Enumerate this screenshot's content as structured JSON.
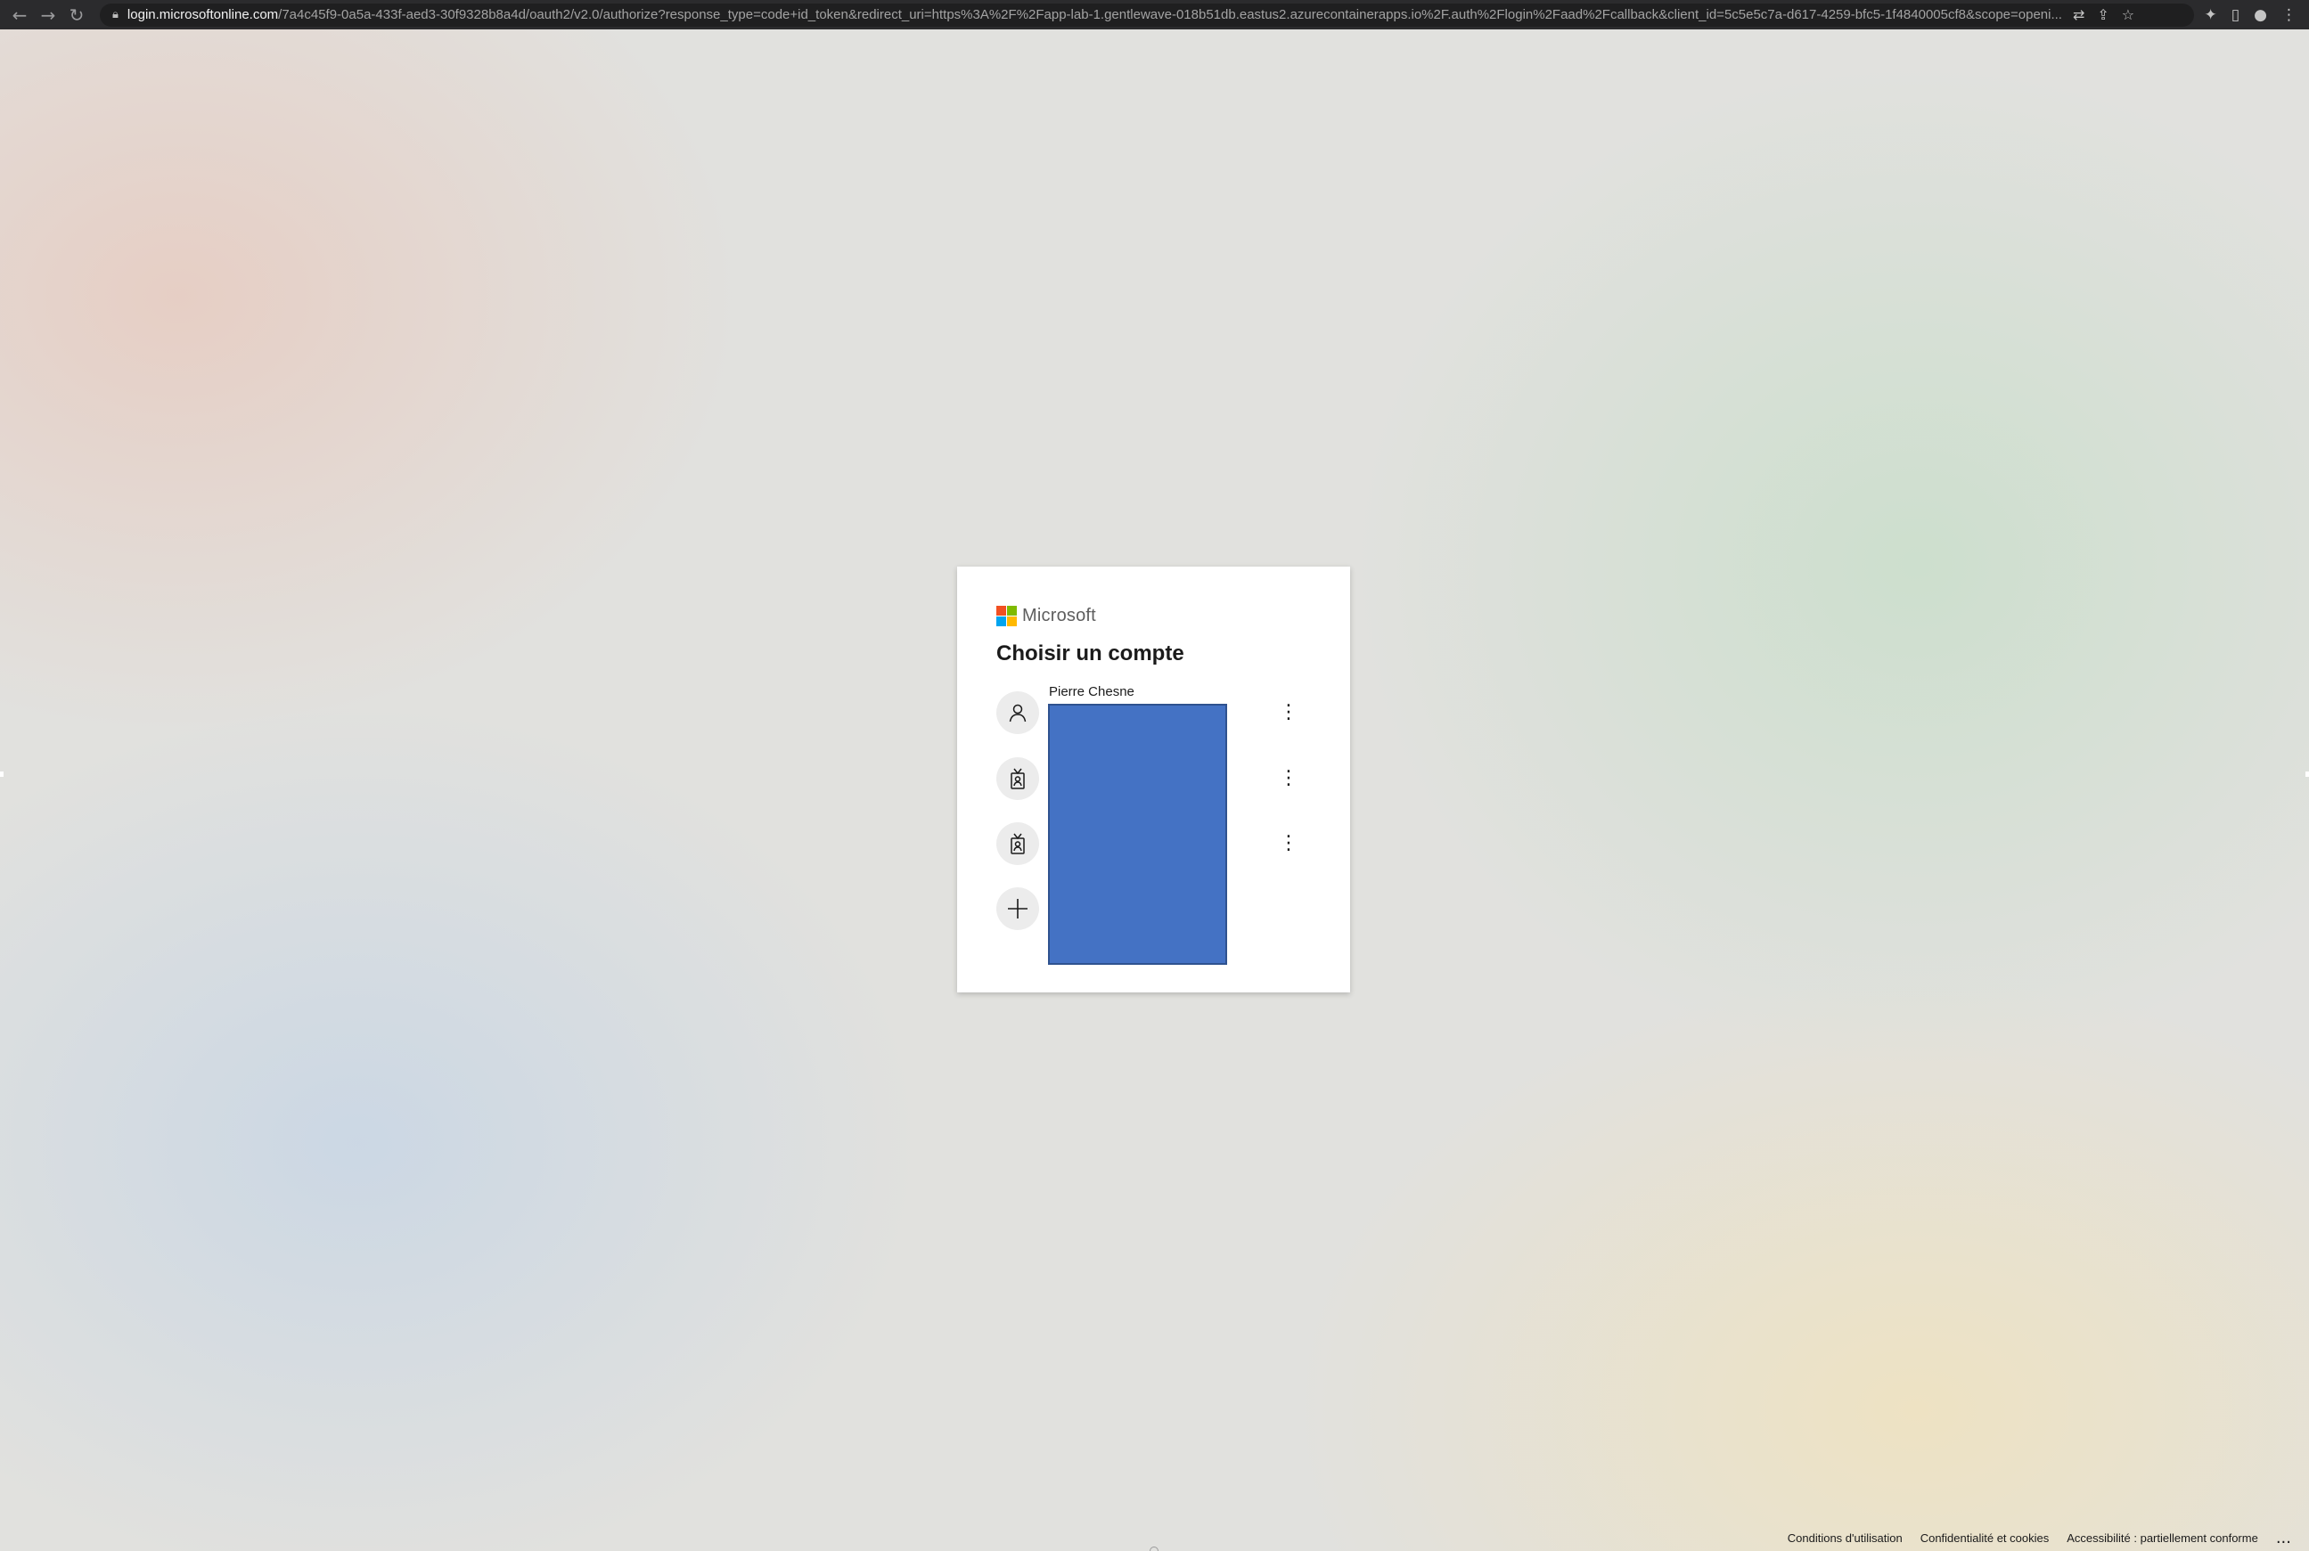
{
  "browser": {
    "url_host": "login.microsoftonline.com",
    "url_path": "/7a4c45f9-0a5a-433f-aed3-30f9328b8a4d/oauth2/v2.0/authorize?response_type=code+id_token&redirect_uri=https%3A%2F%2Fapp-lab-1.gentlewave-018b51db.eastus2.azurecontainerapps.io%2F.auth%2Flogin%2Faad%2Fcallback&client_id=5c5e5c7a-d617-4259-bfc5-1f4840005cf8&scope=openi..."
  },
  "card": {
    "brand": "Microsoft",
    "title": "Choisir un compte",
    "accounts": [
      {
        "name": "Pierre Chesne",
        "icon": "person-icon"
      },
      {
        "name": "",
        "icon": "badge-icon"
      },
      {
        "name": "",
        "icon": "badge-icon"
      }
    ],
    "add_account_icon": "plus-icon"
  },
  "footer": {
    "terms": "Conditions d'utilisation",
    "privacy": "Confidentialité et cookies",
    "accessibility": "Accessibilité : partiellement conforme",
    "more": "..."
  },
  "colors": {
    "ms_red": "#f25022",
    "ms_green": "#7fba00",
    "ms_blue": "#00a4ef",
    "ms_yellow": "#ffb900",
    "redaction": "#4472c4"
  }
}
